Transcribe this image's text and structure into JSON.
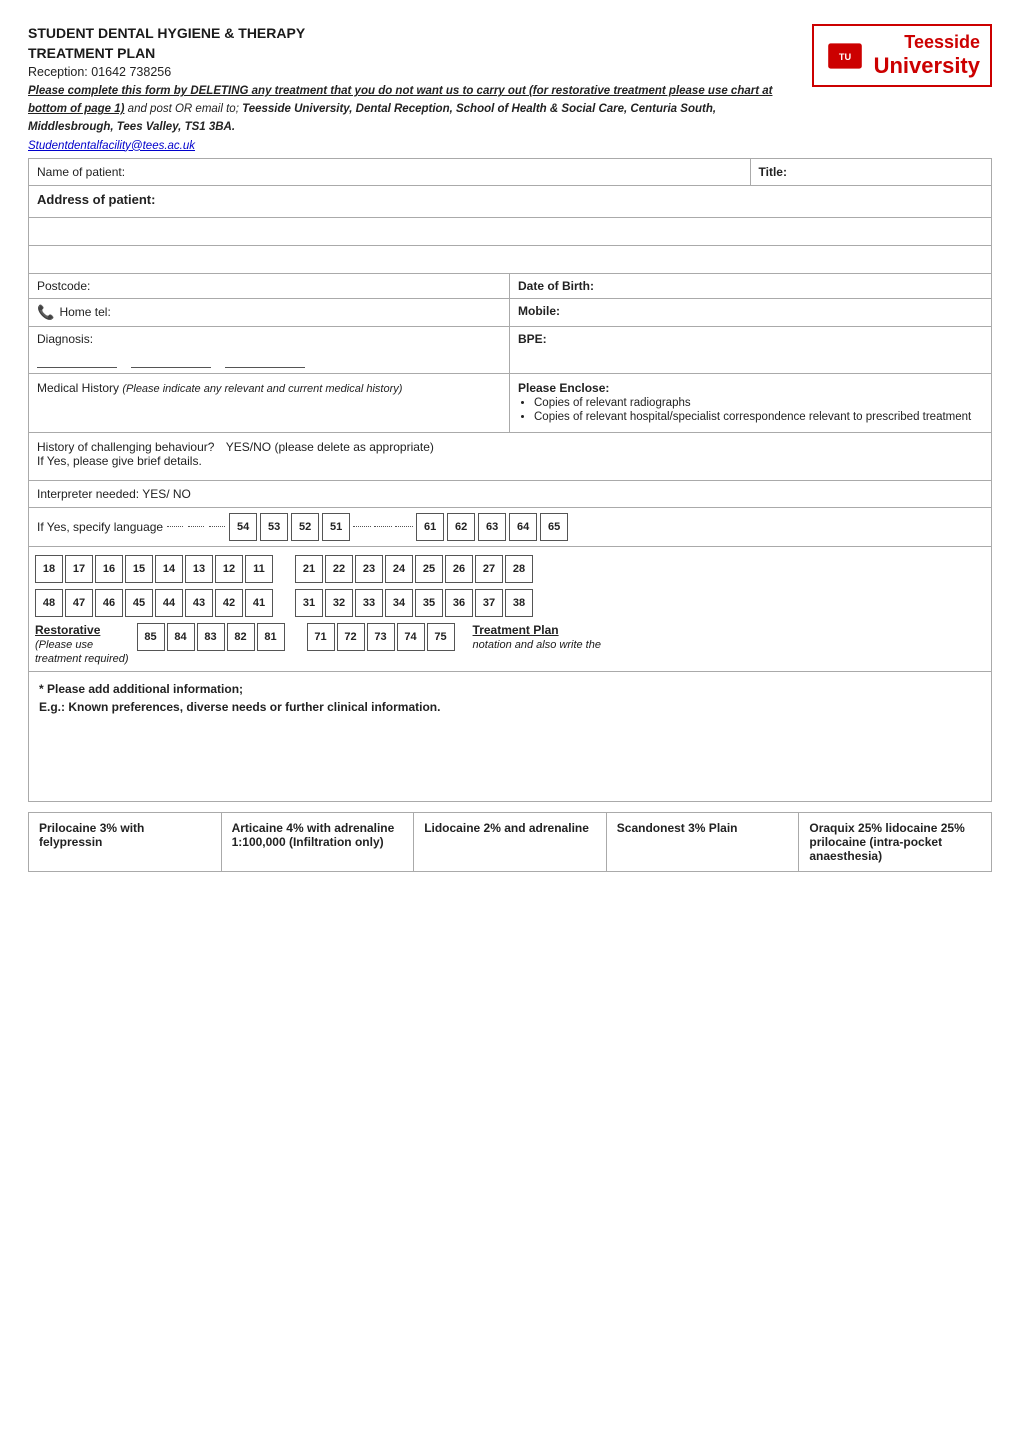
{
  "header": {
    "title_line1": "STUDENT DENTAL HYGIENE & THERAPY",
    "title_line2": "TREATMENT PLAN",
    "reception": "Reception: 01642 738256",
    "instruction_bold": "Please complete this form by DELETING any treatment that you do not want us to carry out (for restorative treatment please use chart at bottom of page 1)",
    "instruction_normal": " and post OR email to; ",
    "instruction_bold2": "Teesside University, Dental Reception, School of Health & Social Care, Centuria South, Middlesbrough, Tees Valley, TS1 3BA.",
    "email": "Studentdentalfacility@tees.ac.uk"
  },
  "logo": {
    "line1": "Teesside",
    "line2": "University"
  },
  "form": {
    "name_label": "Name of patient:",
    "title_label": "Title:",
    "address_label": "Address of patient:",
    "postcode_label": "Postcode:",
    "dob_label": "Date of Birth:",
    "tel_label": "Home tel:",
    "mobile_label": "Mobile:",
    "diagnosis_label": "Diagnosis:",
    "bpe_label": "BPE:",
    "med_history_label": "Medical History",
    "med_history_sub": "(Please indicate any relevant and current medical history)",
    "please_enclose_label": "Please Enclose:",
    "enclose_items": [
      "Copies of relevant radiographs",
      "Copies of relevant hospital/specialist correspondence relevant to prescribed treatment"
    ],
    "challenging_label": "History of challenging behaviour?",
    "challenging_value": "YES/NO  (please delete as appropriate)",
    "challenging_sub": "If Yes, please give brief details.",
    "interpreter_label": "Interpreter needed:   YES/ NO",
    "lang_label": "If Yes, specify language"
  },
  "teeth": {
    "upper_right": [
      "54",
      "53",
      "52",
      "51"
    ],
    "upper_left": [
      "61",
      "62",
      "63",
      "64",
      "65"
    ],
    "upper_right_adult": [
      "18",
      "17",
      "16",
      "15",
      "14",
      "13",
      "12",
      "11"
    ],
    "upper_left_adult": [
      "21",
      "22",
      "23",
      "24",
      "25",
      "26",
      "27",
      "28"
    ],
    "lower_right_adult": [
      "48",
      "47",
      "46",
      "45",
      "44",
      "43",
      "42",
      "41"
    ],
    "lower_left_adult": [
      "31",
      "32",
      "33",
      "34",
      "35",
      "36",
      "37",
      "38"
    ],
    "lower_right_restorative": [
      "85",
      "84",
      "83",
      "82",
      "81"
    ],
    "lower_left_restorative": [
      "71",
      "72",
      "73",
      "74",
      "75"
    ],
    "restorative_label": "Restorative",
    "restorative_sub1": "(Please use",
    "restorative_sub2": "treatment required)",
    "treatment_plan_label": "Treatment Plan",
    "treatment_plan_sub": "notation and also write the"
  },
  "additional": {
    "heading": "* Please add additional information;",
    "subtext": "E.g.: Known preferences, diverse needs or further clinical information."
  },
  "anaesthetic": {
    "items": [
      {
        "name": "Prilocaine 3% with felypressin"
      },
      {
        "name": "Articaine 4% with adrenaline 1:100,000 (Infiltration only)"
      },
      {
        "name": "Lidocaine 2% and adrenaline"
      },
      {
        "name": "Scandonest 3% Plain"
      },
      {
        "name": "Oraquix 25% lidocaine 25% prilocaine (intra-pocket anaesthesia)"
      }
    ]
  }
}
